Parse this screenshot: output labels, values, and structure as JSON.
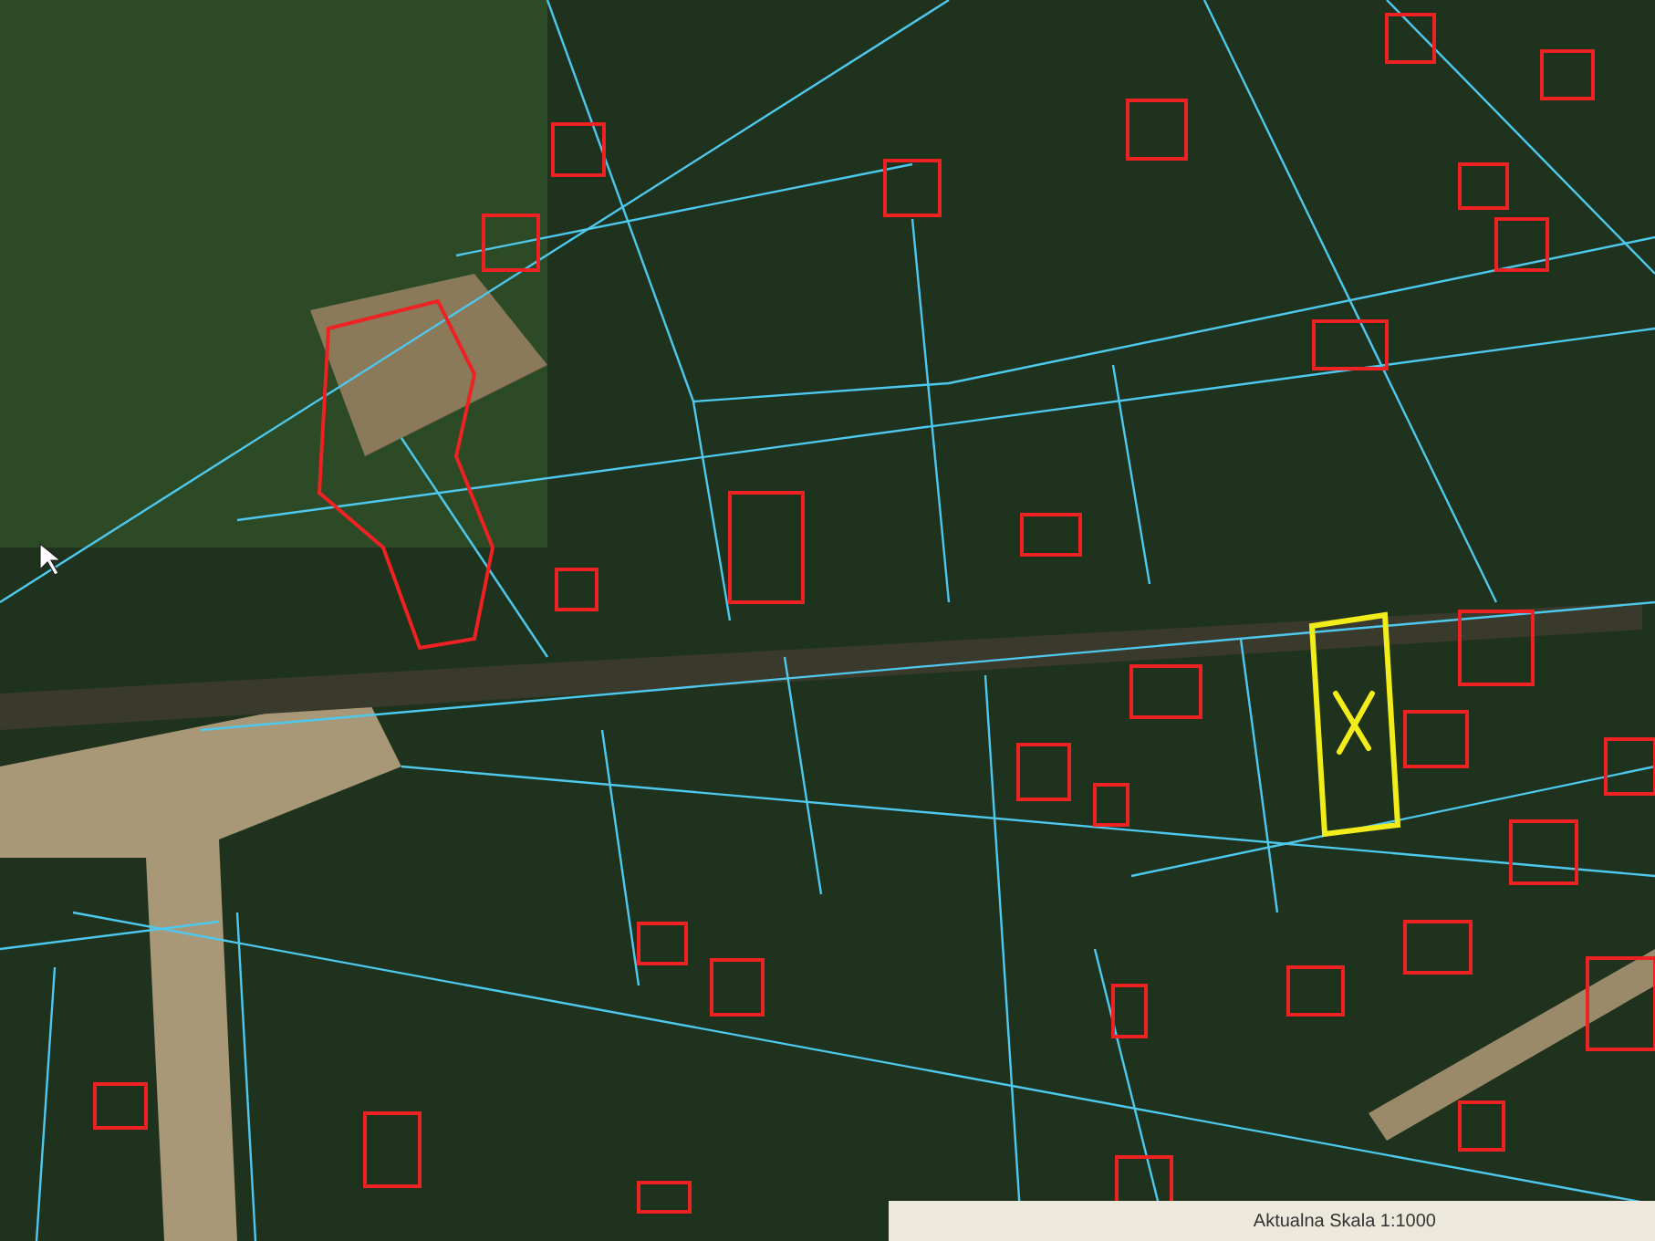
{
  "status_bar": {
    "scale": "Aktualna Skala 1:1000"
  }
}
